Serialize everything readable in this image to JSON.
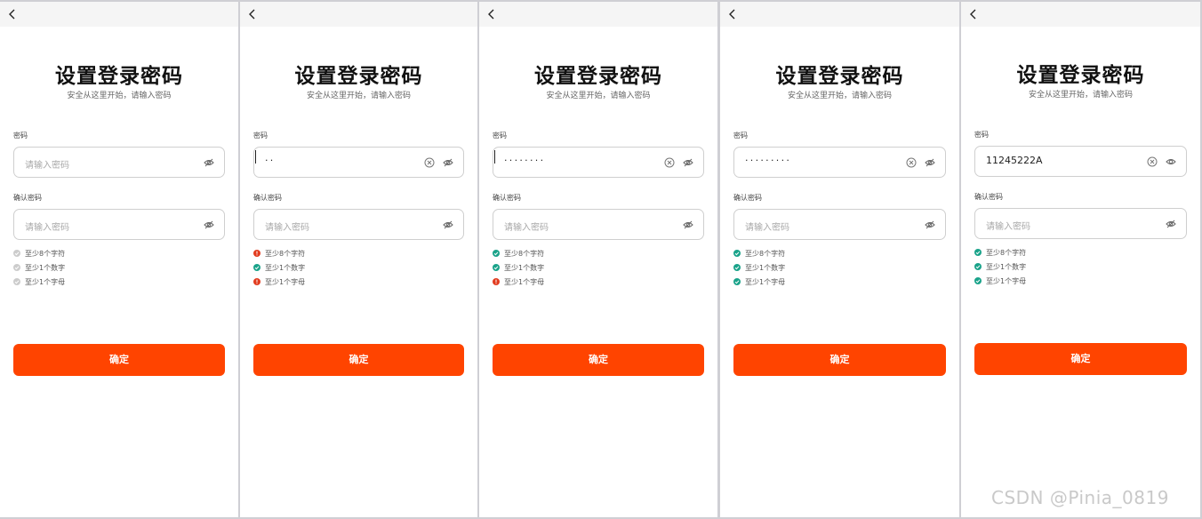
{
  "screen": {
    "title": "设置登录密码",
    "subtitle": "安全从这里开始，请输入密码",
    "password_label": "密码",
    "confirm_label": "确认密码",
    "placeholder": "请输入密码",
    "confirm_button": "确定",
    "rules": [
      "至少8个字符",
      "至少1个数字",
      "至少1个字母"
    ]
  },
  "colors": {
    "accent": "#ff4400",
    "ok": "#1aa38a",
    "error": "#e23c1f",
    "neutral": "#cccccc"
  },
  "icons": [
    "back-icon",
    "eye-off-icon",
    "eye-icon",
    "clear-icon",
    "check-circle-icon",
    "error-circle-icon"
  ],
  "states": [
    {
      "password_value": "",
      "masked": true,
      "caret": false,
      "show_clear": false,
      "eye": "eye-off",
      "rule_status": [
        "neutral",
        "neutral",
        "neutral"
      ]
    },
    {
      "password_value": "··",
      "masked": true,
      "caret": true,
      "show_clear": true,
      "eye": "eye-off",
      "rule_status": [
        "error",
        "ok",
        "error"
      ]
    },
    {
      "password_value": "········",
      "masked": true,
      "caret": true,
      "show_clear": true,
      "eye": "eye-off",
      "rule_status": [
        "ok",
        "ok",
        "error"
      ]
    },
    {
      "password_value": "·········",
      "masked": true,
      "caret": false,
      "show_clear": true,
      "eye": "eye-off",
      "rule_status": [
        "ok",
        "ok",
        "ok"
      ]
    },
    {
      "password_value": "11245222A",
      "masked": false,
      "caret": false,
      "show_clear": true,
      "eye": "eye",
      "rule_status": [
        "ok",
        "ok",
        "ok"
      ]
    }
  ],
  "watermark": "CSDN @Pinia_0819"
}
